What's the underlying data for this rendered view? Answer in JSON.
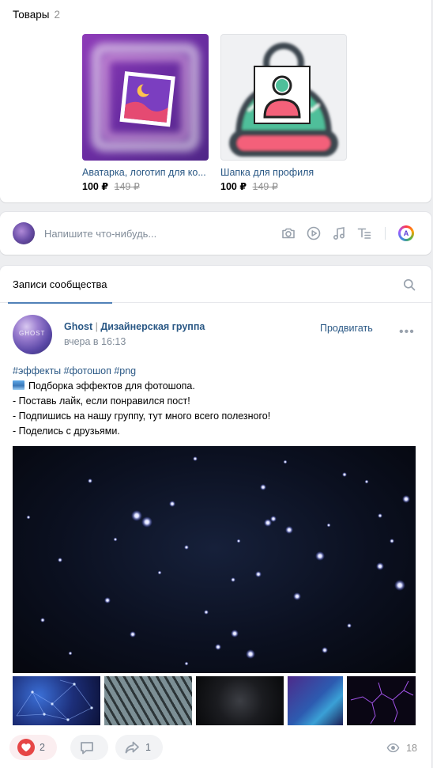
{
  "goods": {
    "title": "Товары",
    "count": "2",
    "items": [
      {
        "name": "Аватарка, логотип для ко...",
        "price": "100 ₽",
        "old_price": "149 ₽"
      },
      {
        "name": "Шапка для профиля",
        "price": "100 ₽",
        "old_price": "149 ₽"
      }
    ]
  },
  "composer": {
    "placeholder": "Напишите что-нибудь...",
    "tools": [
      "camera-icon",
      "video-icon",
      "music-icon",
      "text-format-icon",
      "aura-icon"
    ],
    "aura_letter": "A"
  },
  "wall": {
    "tab_label": "Записи сообщества",
    "post": {
      "avatar_text": "GHOST",
      "author_name": "Ghost",
      "author_separator": "|",
      "author_suffix": "Дизайнерская группа",
      "time": "вчера в 16:13",
      "promote_label": "Продвигать",
      "more_label": "•••",
      "hashtags": "#эффекты #фотошоп #png",
      "lines": [
        "Подборка эффектов для фотошопа.",
        "- Поставь лайк, если понравился пост!",
        "- Подпишись на нашу группу, тут много всего полезного!",
        "- Поделись с друзьями."
      ],
      "likes": "2",
      "shares": "1",
      "views": "18"
    }
  },
  "colors": {
    "link": "#2a5885",
    "accent": "#5181b8",
    "like": "#e64646",
    "secondary": "#818c99"
  }
}
